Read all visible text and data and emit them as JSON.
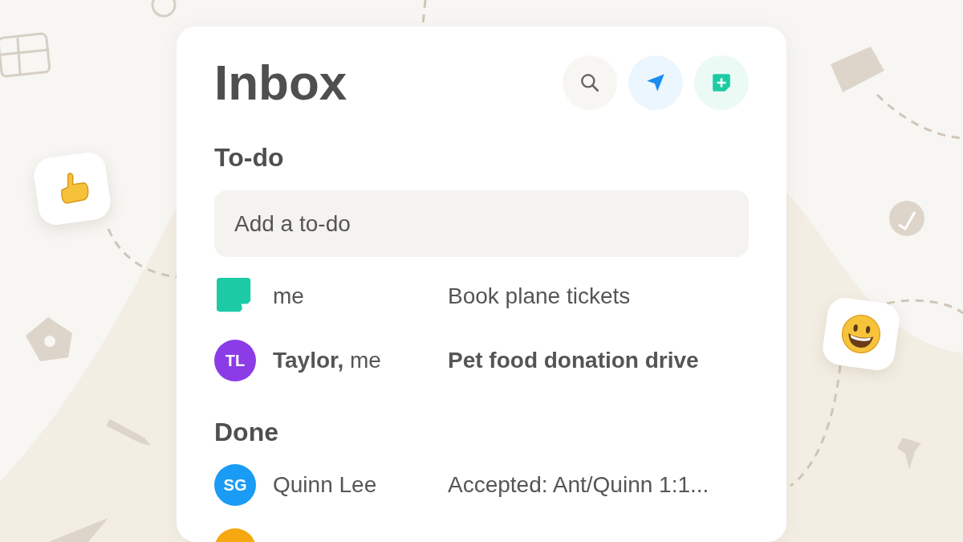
{
  "title": "Inbox",
  "actions": [
    {
      "kind": "search"
    },
    {
      "kind": "send"
    },
    {
      "kind": "new"
    }
  ],
  "sections": [
    {
      "heading": "To-do",
      "input": {
        "placeholder": "Add a to-do"
      },
      "items": [
        {
          "avatar": {
            "kind": "note",
            "color": "#1ccba5"
          },
          "from": "me",
          "subject": "Book plane tickets",
          "unread": false
        },
        {
          "avatar": {
            "kind": "initials",
            "initials": "TL",
            "color": "#8b3ce6"
          },
          "from": "**Taylor,** me",
          "subject": "Pet food donation drive",
          "unread": true
        }
      ]
    },
    {
      "heading": "Done",
      "items": [
        {
          "avatar": {
            "kind": "initials",
            "initials": "SG",
            "color": "#1a9bf5"
          },
          "from": "Quinn Lee",
          "subject": "Accepted: Ant/Quinn 1:1...",
          "unread": false
        },
        {
          "avatar": {
            "kind": "initials",
            "color": "#f5a80f"
          }
        }
      ]
    }
  ]
}
